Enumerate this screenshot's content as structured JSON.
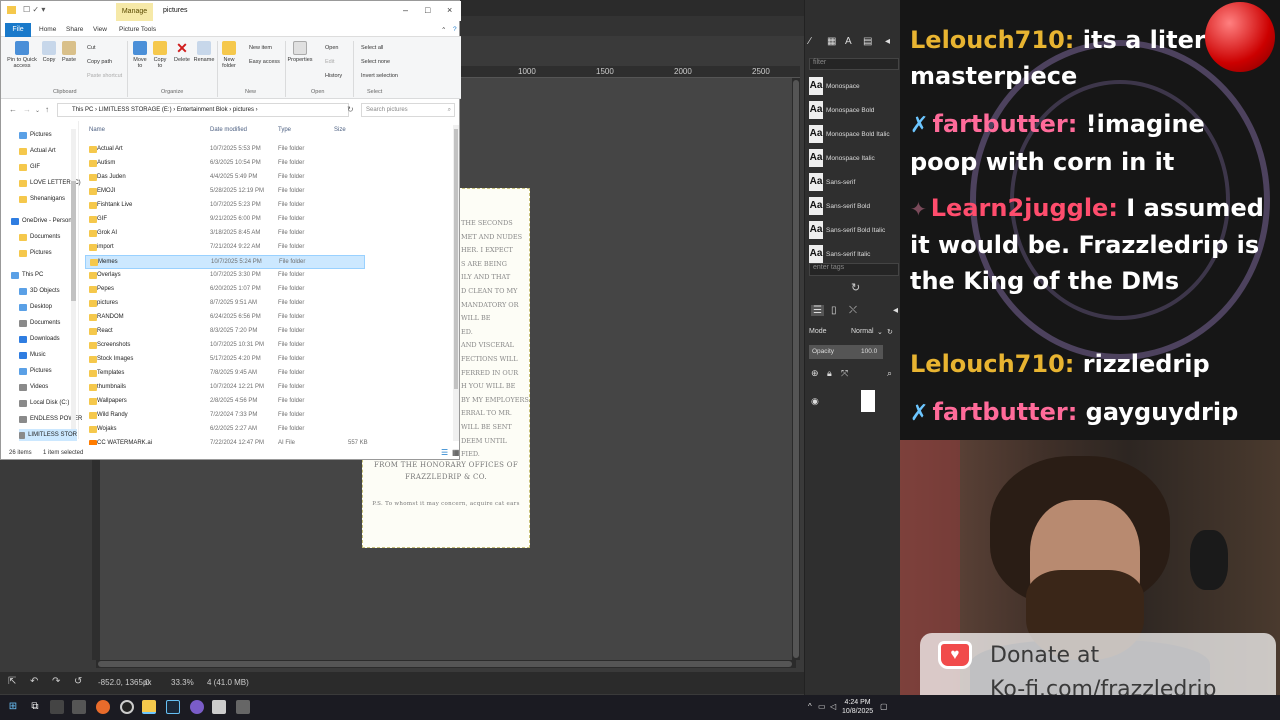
{
  "explorer": {
    "title": "pictures",
    "manage_tab": "Manage",
    "ribbon_tabs": [
      "File",
      "Home",
      "Share",
      "View",
      "Picture Tools"
    ],
    "ribbon": {
      "pin": "Pin to Quick access",
      "copy": "Copy",
      "paste": "Paste",
      "cut": "Cut",
      "copy_path": "Copy path",
      "paste_shortcut": "Paste shortcut",
      "move_to": "Move to",
      "copy_to": "Copy to",
      "delete": "Delete",
      "rename": "Rename",
      "new_folder": "New folder",
      "new_item": "New item",
      "easy_access": "Easy access",
      "properties": "Properties",
      "open": "Open",
      "edit": "Edit",
      "history": "History",
      "select_all": "Select all",
      "select_none": "Select none",
      "invert_selection": "Invert selection",
      "groups": [
        "Clipboard",
        "Organize",
        "New",
        "Open",
        "Select"
      ]
    },
    "breadcrumb": "This PC  ›  LIMITLESS STORAGE (E:)  ›  Entertainment Blok  ›  pictures  ›",
    "search_placeholder": "Search pictures",
    "nav": [
      {
        "label": "Pictures",
        "color": "#5aa0e6"
      },
      {
        "label": "Actual Art",
        "color": "#f5c84c"
      },
      {
        "label": "GIF",
        "color": "#f5c84c"
      },
      {
        "label": "LOVE LETTER (C)",
        "color": "#f5c84c"
      },
      {
        "label": "Shenanigans",
        "color": "#f5c84c"
      },
      {
        "label": "OneDrive - Person",
        "color": "#2f7de1"
      },
      {
        "label": "Documents",
        "color": "#f5c84c"
      },
      {
        "label": "Pictures",
        "color": "#f5c84c"
      },
      {
        "label": "This PC",
        "color": "#5aa0e6"
      },
      {
        "label": "3D Objects",
        "color": "#5aa0e6"
      },
      {
        "label": "Desktop",
        "color": "#5aa0e6"
      },
      {
        "label": "Documents",
        "color": "#8a8a8a"
      },
      {
        "label": "Downloads",
        "color": "#2f7de1"
      },
      {
        "label": "Music",
        "color": "#2f7de1"
      },
      {
        "label": "Pictures",
        "color": "#5aa0e6"
      },
      {
        "label": "Videos",
        "color": "#8a8a8a"
      },
      {
        "label": "Local Disk (C:)",
        "color": "#8a8a8a"
      },
      {
        "label": "ENDLESS POWER",
        "color": "#8a8a8a"
      },
      {
        "label": "LIMITLESS STOR",
        "color": "#8a8a8a"
      }
    ],
    "columns": [
      "Name",
      "Date modified",
      "Type",
      "Size"
    ],
    "files": [
      {
        "name": "Actual Art",
        "date": "10/7/2025 5:53 PM",
        "type": "File folder",
        "size": ""
      },
      {
        "name": "Autism",
        "date": "6/3/2025 10:54 PM",
        "type": "File folder",
        "size": ""
      },
      {
        "name": "Das Juden",
        "date": "4/4/2025 5:49 PM",
        "type": "File folder",
        "size": ""
      },
      {
        "name": "EMOJI",
        "date": "5/28/2025 12:19 PM",
        "type": "File folder",
        "size": ""
      },
      {
        "name": "Fishtank Live",
        "date": "10/7/2025 5:23 PM",
        "type": "File folder",
        "size": ""
      },
      {
        "name": "GIF",
        "date": "9/21/2025 6:00 PM",
        "type": "File folder",
        "size": ""
      },
      {
        "name": "Grok AI",
        "date": "3/18/2025 8:45 AM",
        "type": "File folder",
        "size": ""
      },
      {
        "name": "import",
        "date": "7/21/2024 9:22 AM",
        "type": "File folder",
        "size": ""
      },
      {
        "name": "Memes",
        "date": "10/7/2025 5:24 PM",
        "type": "File folder",
        "size": "",
        "selected": true
      },
      {
        "name": "Overlays",
        "date": "10/7/2025 3:30 PM",
        "type": "File folder",
        "size": ""
      },
      {
        "name": "Pepes",
        "date": "6/20/2025 1:07 PM",
        "type": "File folder",
        "size": ""
      },
      {
        "name": "pictures",
        "date": "8/7/2025 9:51 AM",
        "type": "File folder",
        "size": ""
      },
      {
        "name": "RANDOM",
        "date": "6/24/2025 6:56 PM",
        "type": "File folder",
        "size": ""
      },
      {
        "name": "React",
        "date": "8/3/2025 7:20 PM",
        "type": "File folder",
        "size": ""
      },
      {
        "name": "Screenshots",
        "date": "10/7/2025 10:31 PM",
        "type": "File folder",
        "size": ""
      },
      {
        "name": "Stock Images",
        "date": "5/17/2025 4:20 PM",
        "type": "File folder",
        "size": ""
      },
      {
        "name": "Templates",
        "date": "7/8/2025 9:45 AM",
        "type": "File folder",
        "size": ""
      },
      {
        "name": "thumbnails",
        "date": "10/7/2024 12:21 PM",
        "type": "File folder",
        "size": ""
      },
      {
        "name": "Wallpapers",
        "date": "2/8/2025 4:56 PM",
        "type": "File folder",
        "size": ""
      },
      {
        "name": "Wild Randy",
        "date": "7/2/2024 7:33 PM",
        "type": "File folder",
        "size": ""
      },
      {
        "name": "Wojaks",
        "date": "6/2/2025 2:27 AM",
        "type": "File folder",
        "size": ""
      },
      {
        "name": "CC WATERMARK.ai",
        "date": "7/22/2024 12:47 PM",
        "type": "AI File",
        "size": "557 KB"
      }
    ],
    "status_count": "26 items",
    "status_selected": "1 item selected"
  },
  "gimp": {
    "ruler_ticks": [
      "1000",
      "1500",
      "2000",
      "2500"
    ],
    "doc_fragments": [
      "THE SECONDS",
      "MET AND NUDES",
      "HER. I EXPECT",
      "S ARE BEING",
      "ILY AND THAT",
      "D CLEAN TO MY",
      "MANDATORY OR",
      "WILL BE",
      "ED.",
      "AND VISCERAL",
      "FECTIONS WILL",
      "FERRED IN OUR",
      "H YOU WILL BE",
      "BY MY EMPLOYERS.",
      "ERRAL TO MR.",
      "WILL BE SENT",
      "DEEM UNTIL",
      "FIED."
    ],
    "doc_footer1": "FROM THE HONORARY OFFICES OF",
    "doc_footer2": "FRAZZLEDRIP & CO.",
    "doc_ps": "P.S. To whomst it may concern, acquire cat ears",
    "font_filter": "filter",
    "fonts": [
      "Monospace",
      "Monospace Bold",
      "Monospace Bold Italic",
      "Monospace Italic",
      "Sans-serif",
      "Sans-serif Bold",
      "Sans-serif Bold Italic",
      "Sans-serif Italic"
    ],
    "tags_placeholder": "enter tags",
    "mode_label": "Mode",
    "mode_value": "Normal",
    "opacity_label": "Opacity",
    "opacity_value": "100.0",
    "status_coords": "-852.0, 1365.0",
    "status_unit": "px",
    "status_zoom": "33.3%",
    "status_info": "4 (41.0 MB)"
  },
  "chat": {
    "messages": [
      {
        "user": "Lelouch710:",
        "text": " its a liter masterpiece",
        "color": "gold",
        "badge": ""
      },
      {
        "user": "fartbutter:",
        "text": " !imagine poop with corn in it",
        "color": "pink",
        "badge": "sword"
      },
      {
        "user": "Learn2juggle:",
        "text": " I assumed it would be. Frazzledrip is the King of the DMs",
        "color": "red",
        "badge": "dark"
      },
      {
        "user": "Lelouch710:",
        "text": " rizzledrip",
        "color": "gold",
        "badge": ""
      },
      {
        "user": "fartbutter:",
        "text": " gayguydrip",
        "color": "pink",
        "badge": "sword"
      }
    ]
  },
  "donate": {
    "line1": "Donate at",
    "line2": "Ko-fi.com/frazzledrip"
  },
  "taskbar": {
    "time": "4:24 PM",
    "date": "10/8/2025"
  }
}
